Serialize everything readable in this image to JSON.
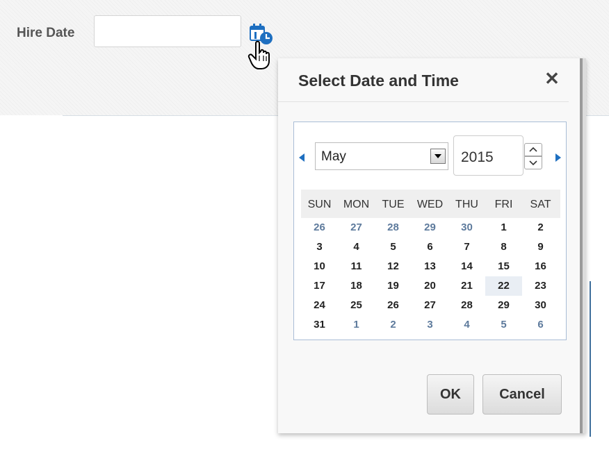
{
  "form": {
    "hire_date_label": "Hire Date",
    "hire_date_value": ""
  },
  "dialog": {
    "title": "Select Date and Time",
    "close_glyph": "✕",
    "month": "May",
    "year": "2015",
    "weekdays": [
      "SUN",
      "MON",
      "TUE",
      "WED",
      "THU",
      "FRI",
      "SAT"
    ],
    "weeks": [
      [
        {
          "d": "26",
          "o": true
        },
        {
          "d": "27",
          "o": true
        },
        {
          "d": "28",
          "o": true
        },
        {
          "d": "29",
          "o": true
        },
        {
          "d": "30",
          "o": true
        },
        {
          "d": "1"
        },
        {
          "d": "2"
        }
      ],
      [
        {
          "d": "3"
        },
        {
          "d": "4"
        },
        {
          "d": "5"
        },
        {
          "d": "6"
        },
        {
          "d": "7"
        },
        {
          "d": "8"
        },
        {
          "d": "9"
        }
      ],
      [
        {
          "d": "10"
        },
        {
          "d": "11"
        },
        {
          "d": "12"
        },
        {
          "d": "13"
        },
        {
          "d": "14"
        },
        {
          "d": "15"
        },
        {
          "d": "16"
        }
      ],
      [
        {
          "d": "17"
        },
        {
          "d": "18"
        },
        {
          "d": "19"
        },
        {
          "d": "20"
        },
        {
          "d": "21"
        },
        {
          "d": "22",
          "t": true
        },
        {
          "d": "23"
        }
      ],
      [
        {
          "d": "24"
        },
        {
          "d": "25"
        },
        {
          "d": "26"
        },
        {
          "d": "27"
        },
        {
          "d": "28"
        },
        {
          "d": "29"
        },
        {
          "d": "30"
        }
      ],
      [
        {
          "d": "31"
        },
        {
          "d": "1",
          "o": true
        },
        {
          "d": "2",
          "o": true
        },
        {
          "d": "3",
          "o": true
        },
        {
          "d": "4",
          "o": true
        },
        {
          "d": "5",
          "o": true
        },
        {
          "d": "6",
          "o": true
        }
      ]
    ],
    "ok_label": "OK",
    "cancel_label": "Cancel"
  },
  "colors": {
    "accent": "#1e6fc0",
    "other_month_day": "#5d7a9c",
    "today_highlight": "#e9eef4"
  },
  "icons": [
    "calendar-icon",
    "hand-cursor-icon",
    "close-icon",
    "prev-month-icon",
    "next-month-icon",
    "dropdown-arrow-icon",
    "spin-up-icon",
    "spin-down-icon"
  ]
}
